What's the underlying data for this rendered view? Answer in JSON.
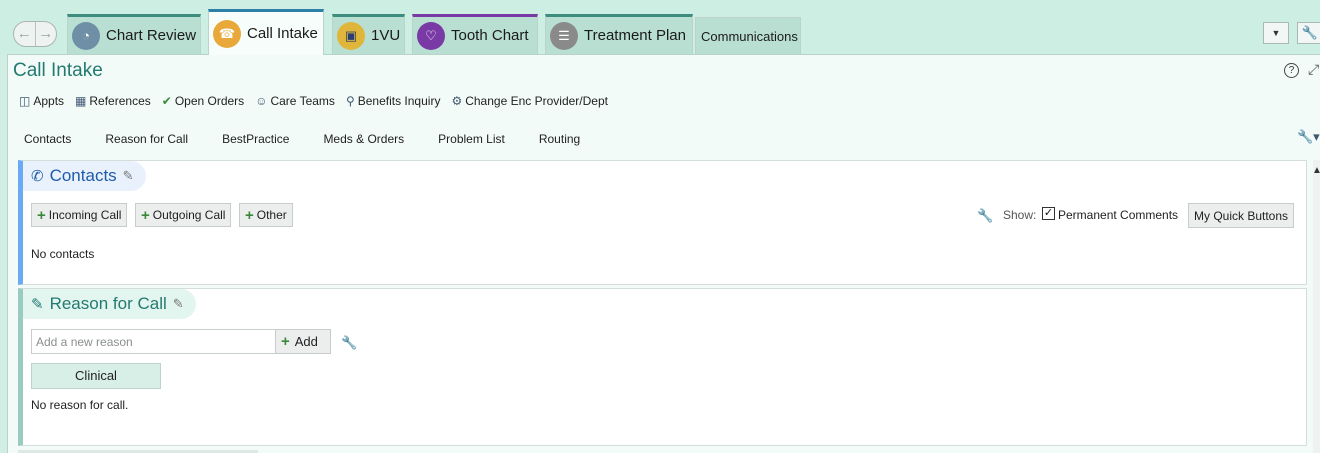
{
  "tabs": [
    {
      "label": "Chart Review",
      "icon": "chart-review-icon",
      "color": "#6f8fa6"
    },
    {
      "label": "Call Intake",
      "icon": "telephone-icon",
      "color": "#e9a93a",
      "active": true
    },
    {
      "label": "1VU",
      "icon": "one-view-icon",
      "color": "#e0b63a"
    },
    {
      "label": "Tooth Chart",
      "icon": "tooth-icon",
      "color": "#7a3aa6"
    },
    {
      "label": "Treatment Plan",
      "icon": "clipboard-icon",
      "color": "#8a8a8a"
    },
    {
      "label": "Communications"
    }
  ],
  "page": {
    "title": "Call Intake"
  },
  "toolbar": {
    "items": [
      {
        "label": "Appts",
        "icon": "appointments-icon"
      },
      {
        "label": "References",
        "icon": "books-icon"
      },
      {
        "label": "Open Orders",
        "icon": "checkmark-icon"
      },
      {
        "label": "Care Teams",
        "icon": "people-icon"
      },
      {
        "label": "Benefits Inquiry",
        "icon": "magnifier-icon"
      },
      {
        "label": "Change Enc Provider/Dept",
        "icon": "provider-icon"
      }
    ]
  },
  "subtabs": [
    "Contacts",
    "Reason for Call",
    "BestPractice",
    "Meds & Orders",
    "Problem List",
    "Routing"
  ],
  "contacts": {
    "title": "Contacts",
    "buttons": {
      "incoming": "Incoming Call",
      "outgoing": "Outgoing Call",
      "other": "Other"
    },
    "show_label": "Show:",
    "permanent_comments": {
      "label": "Permanent Comments",
      "checked": true
    },
    "quick_buttons": "My Quick Buttons",
    "empty_text": "No contacts"
  },
  "reason": {
    "title": "Reason for Call",
    "input_placeholder": "Add a new reason",
    "add_label": "Add",
    "category_tab": "Clinical",
    "empty_text": "No reason for call."
  },
  "colors": {
    "accent_teal": "#237a70",
    "contacts_blue": "#1f5ca8",
    "add_green": "#3a8a3a"
  }
}
